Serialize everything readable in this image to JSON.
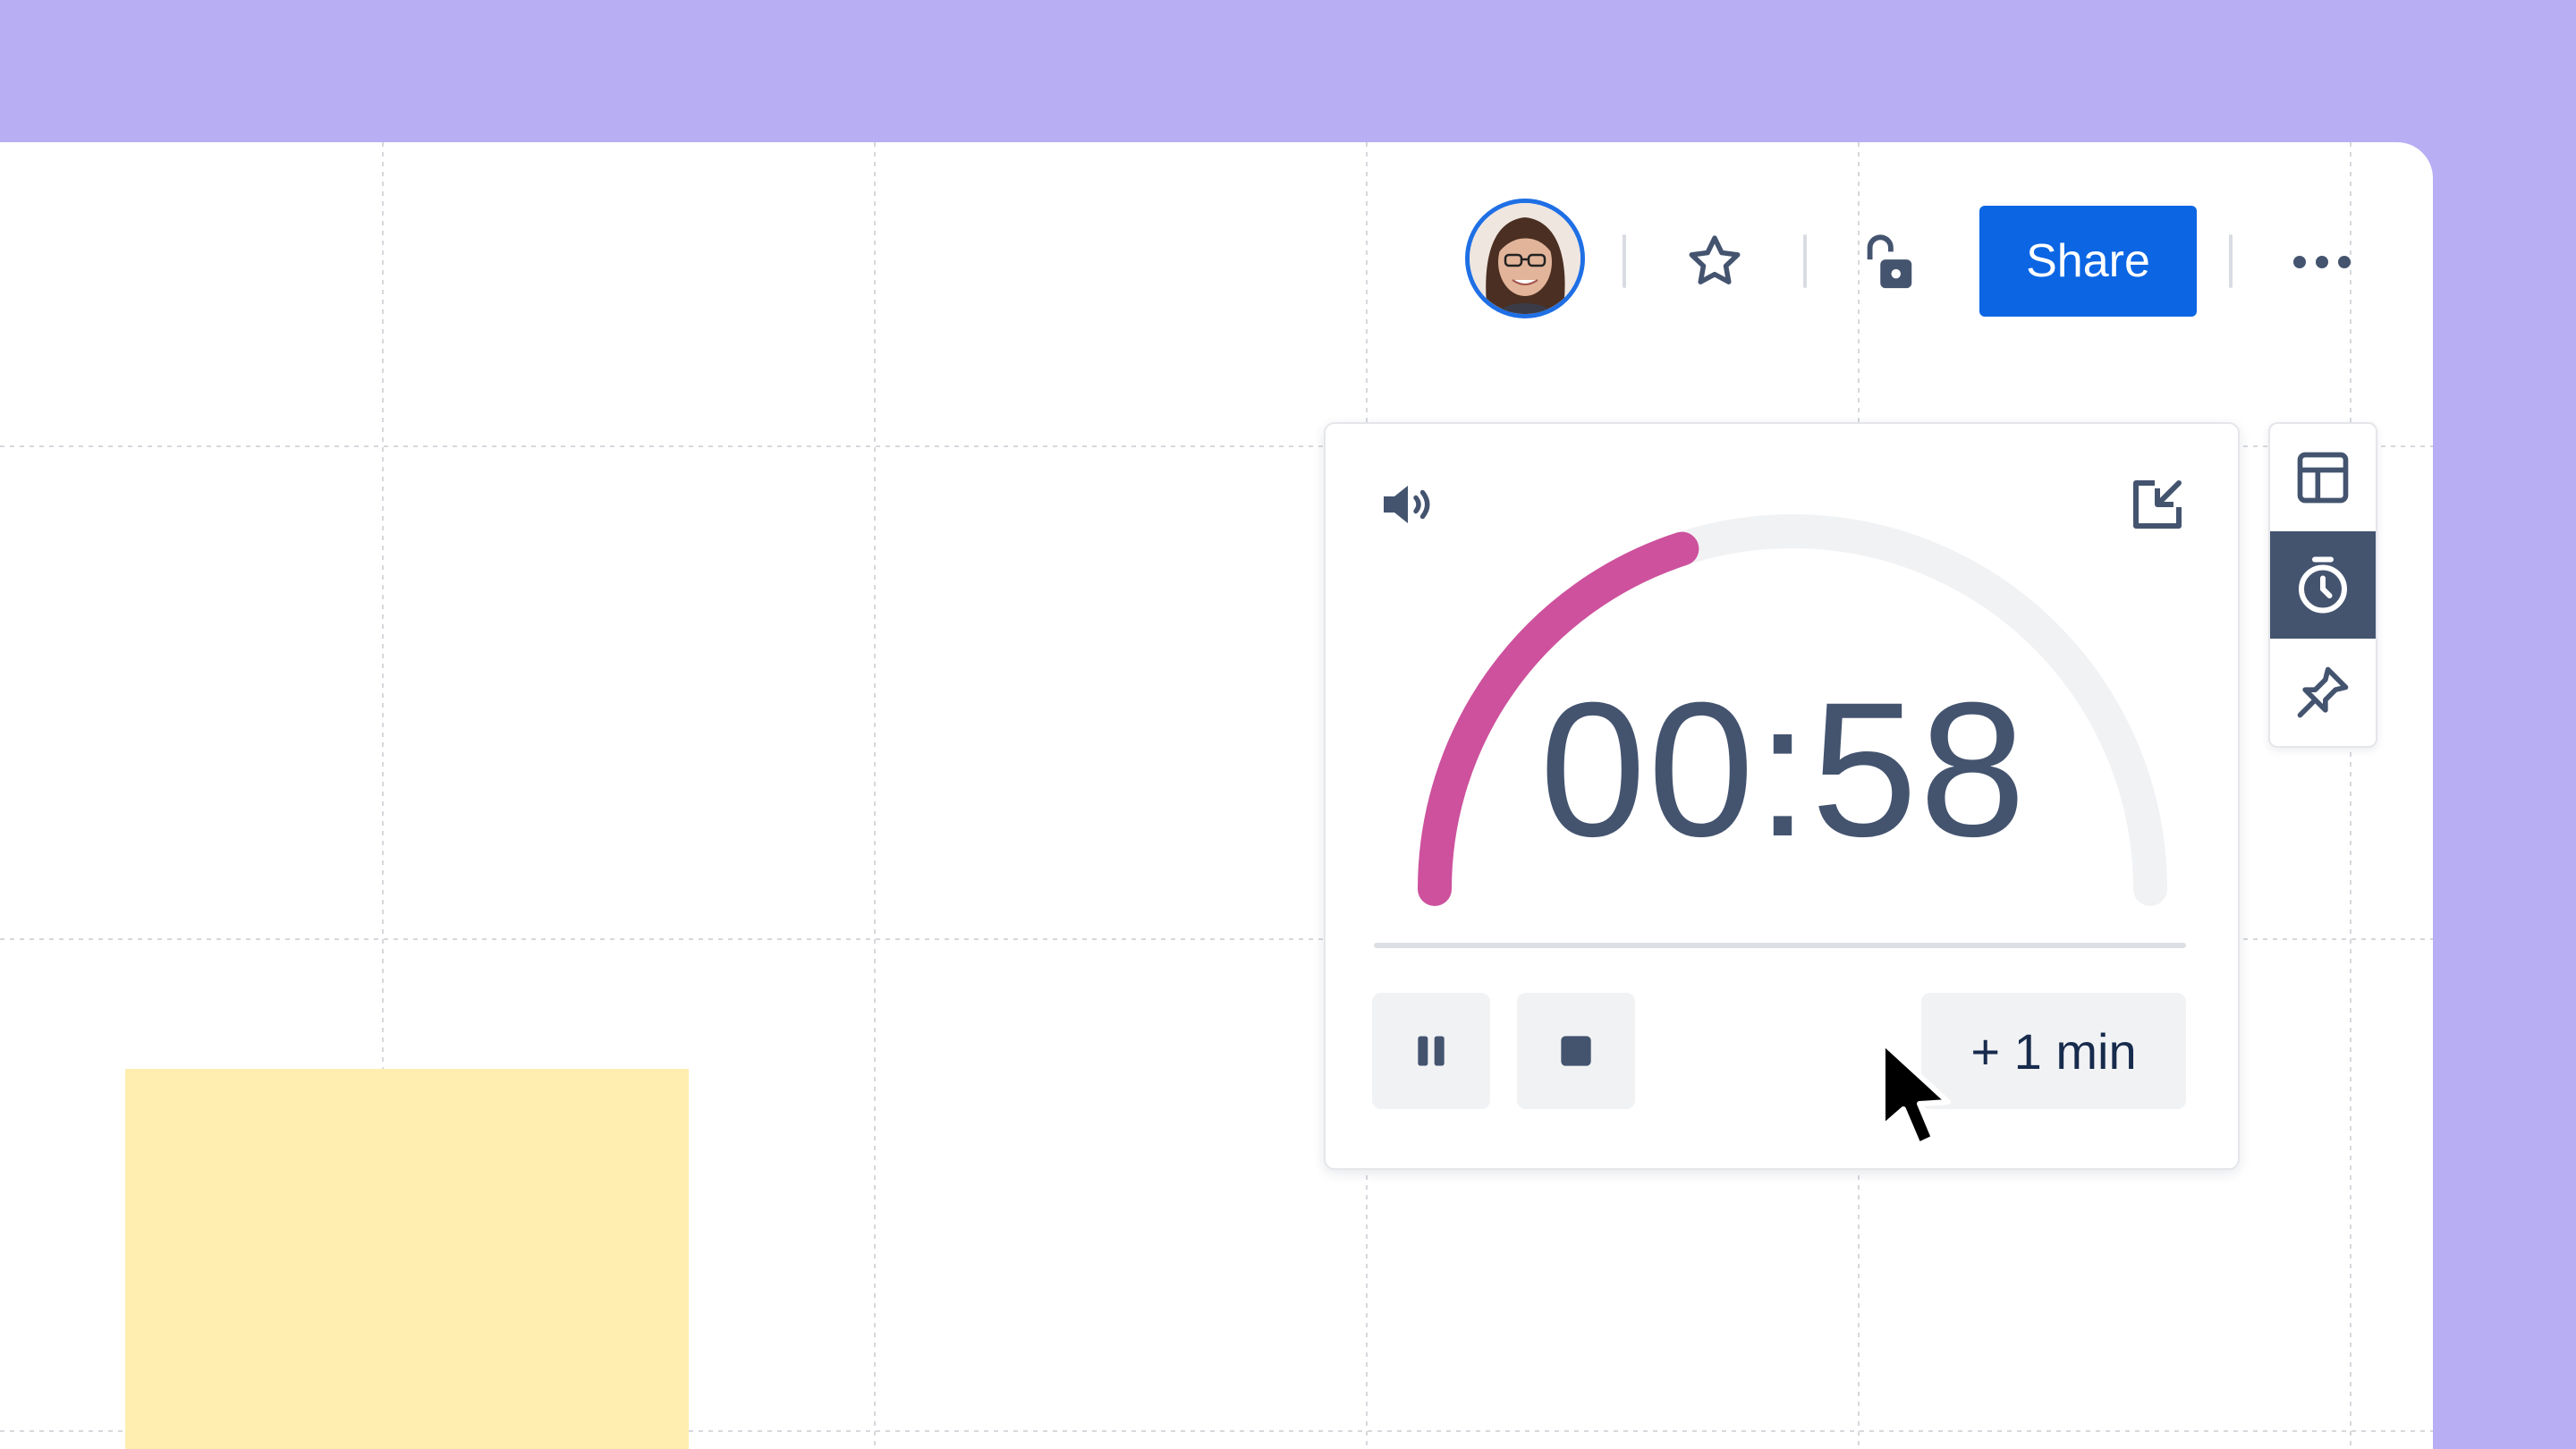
{
  "header": {
    "avatar_alt": "User avatar",
    "share_label": "Share"
  },
  "icons": {
    "star": "star-icon",
    "lock": "unlock-icon",
    "more": "more-icon",
    "sound": "speaker-icon",
    "minimize": "minimize-icon",
    "pause": "pause-icon",
    "stop": "stop-icon",
    "layout": "layout-icon",
    "timer": "stopwatch-icon",
    "pin": "pin-icon"
  },
  "timer": {
    "time": "00:58",
    "progress": 0.4,
    "add_time_label": "+ 1 min"
  },
  "colors": {
    "background": "#b7aef4",
    "accent": "#0c66e4",
    "progress": "#cd519d",
    "track": "#f1f2f4",
    "sticky": "#ffeeb0"
  }
}
